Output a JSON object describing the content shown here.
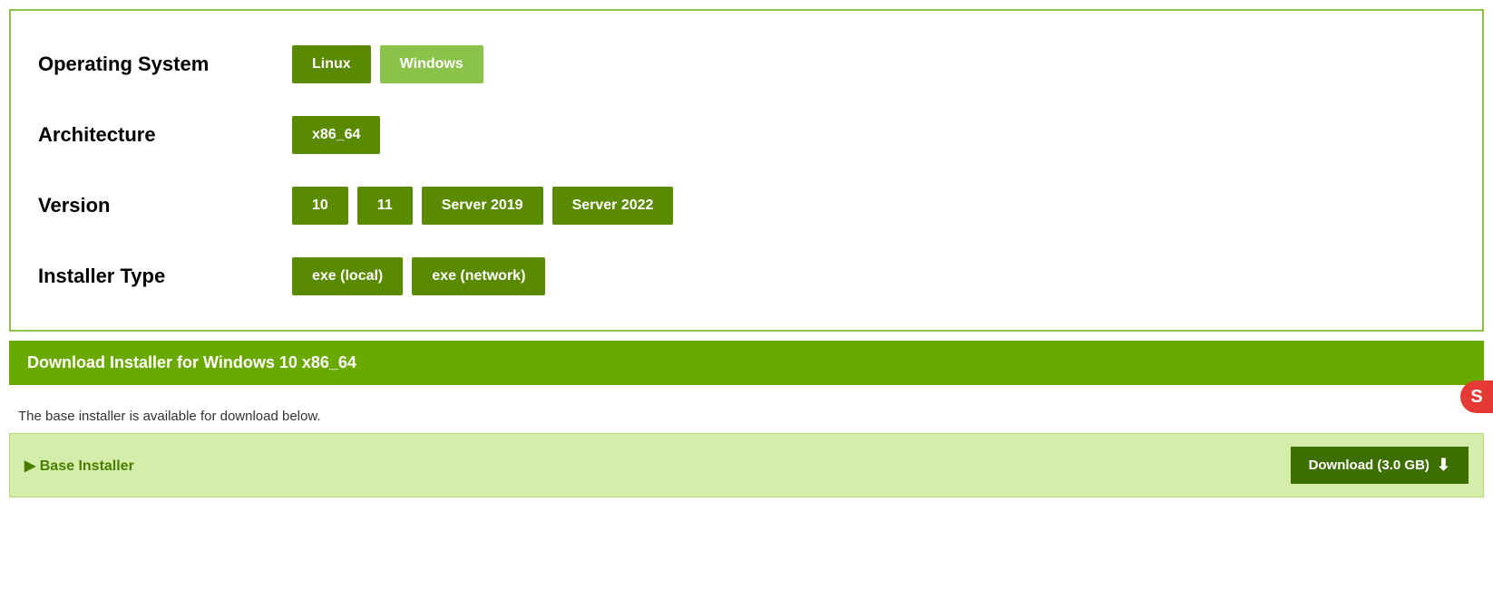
{
  "selector": {
    "rows": [
      {
        "label": "Operating System",
        "buttons": [
          {
            "text": "Linux",
            "state": "active"
          },
          {
            "text": "Windows",
            "state": "inactive"
          }
        ]
      },
      {
        "label": "Architecture",
        "buttons": [
          {
            "text": "x86_64",
            "state": "active"
          }
        ]
      },
      {
        "label": "Version",
        "buttons": [
          {
            "text": "10",
            "state": "active"
          },
          {
            "text": "11",
            "state": "active"
          },
          {
            "text": "Server 2019",
            "state": "active"
          },
          {
            "text": "Server 2022",
            "state": "active"
          }
        ]
      },
      {
        "label": "Installer Type",
        "buttons": [
          {
            "text": "exe (local)",
            "state": "active"
          },
          {
            "text": "exe (network)",
            "state": "active"
          }
        ]
      }
    ]
  },
  "download_bar": {
    "title": "Download Installer for Windows 10 x86_64",
    "description": "The base installer is available for download below.",
    "base_installer_label": "Base Installer",
    "download_button_label": "Download (3.0 GB)"
  }
}
